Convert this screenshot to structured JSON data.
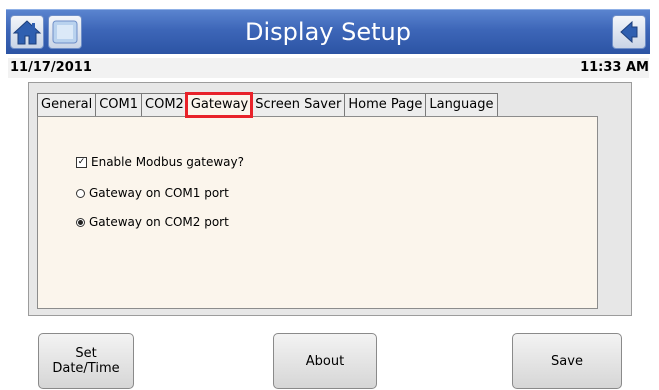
{
  "header": {
    "title": "Display Setup",
    "home_icon": "home-icon",
    "image_icon": "picture-icon",
    "back_icon": "back-arrow-icon",
    "color": "#3d66b8"
  },
  "status": {
    "date": "11/17/2011",
    "time": "11:33 AM"
  },
  "tabs": [
    {
      "label": "General",
      "active": false
    },
    {
      "label": "COM1",
      "active": false
    },
    {
      "label": "COM2",
      "active": false
    },
    {
      "label": "Gateway",
      "active": true
    },
    {
      "label": "Screen Saver",
      "active": false
    },
    {
      "label": "Home Page",
      "active": false
    },
    {
      "label": "Language",
      "active": false
    }
  ],
  "gateway": {
    "enable_label": "Enable Modbus gateway?",
    "enable_checked": true,
    "com1_label": "Gateway on COM1 port",
    "com1_selected": false,
    "com2_label": "Gateway on COM2 port",
    "com2_selected": true
  },
  "buttons": {
    "date_line1": "Set",
    "date_line2": "Date/Time",
    "about": "About",
    "save": "Save"
  },
  "highlight_color": "#e8222a"
}
